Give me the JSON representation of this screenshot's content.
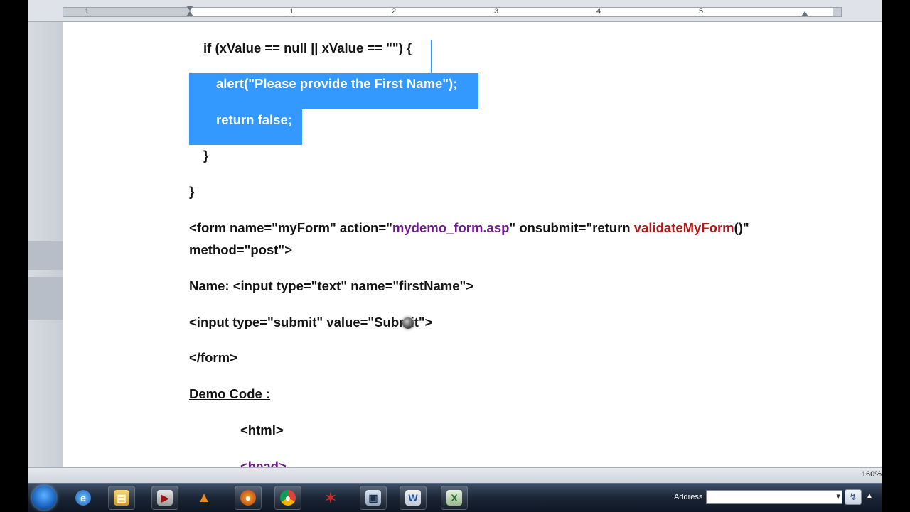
{
  "ruler": {
    "numbers": [
      "1",
      "1",
      "2",
      "3",
      "4",
      "5"
    ]
  },
  "document": {
    "line_if": "if (xValue == null || xValue == \"\") {",
    "line_alert": "alert(\"Please provide the First Name\");",
    "line_return": "return false;",
    "line_close_brace1": "}",
    "line_close_brace2": "}",
    "form_open_a": "<form name=\"myForm\" action=\"",
    "form_action": "mydemo_form.asp",
    "form_open_b": "\" onsubmit=\"return ",
    "form_validate": "validateMyForm",
    "form_open_c": "()\"",
    "form_method": "method=\"post\">",
    "line_name_input": "Name: <input type=\"text\" name=\"firstName\">",
    "line_submit_input": "<input type=\"submit\" value=\"Submit\">",
    "line_form_close": "</form>",
    "demo_heading": "Demo Code :",
    "line_html": "<html>",
    "line_head": "<head>"
  },
  "status": {
    "zoom": "160%"
  },
  "taskbar": {
    "address_label": "Address",
    "address_value": "",
    "icons": [
      "start-orb",
      "ie-icon",
      "explorer-icon",
      "media-player-icon",
      "vlc-icon",
      "firefox-icon",
      "chrome-icon",
      "app-icon",
      "camtasia-icon",
      "word-icon",
      "excel-icon"
    ]
  },
  "colors": {
    "selection": "#3399ff",
    "keyword_purple": "#6b1c8a",
    "keyword_red": "#b01818"
  }
}
